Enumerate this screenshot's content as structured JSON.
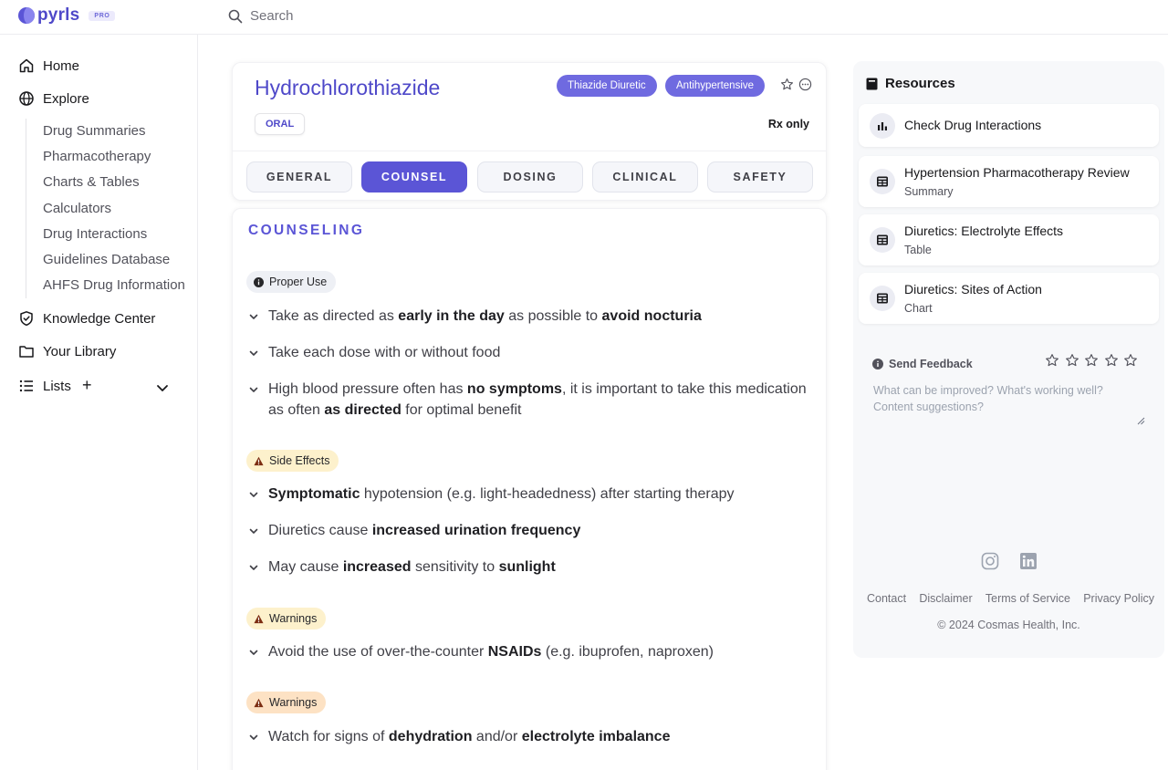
{
  "app": {
    "name": "pyrls",
    "badge": "PRO"
  },
  "search": {
    "placeholder": "Search"
  },
  "sidebar": {
    "home": "Home",
    "explore": "Explore",
    "explore_items": [
      "Drug Summaries",
      "Pharmacotherapy",
      "Charts & Tables",
      "Calculators",
      "Drug Interactions",
      "Guidelines Database",
      "AHFS Drug Information"
    ],
    "knowledge": "Knowledge Center",
    "library": "Your Library",
    "lists": "Lists",
    "lists_add": "+"
  },
  "drug": {
    "name": "Hydrochlorothiazide",
    "tags": [
      "Thiazide Diuretic",
      "Antihypertensive"
    ],
    "route": "ORAL",
    "rx": "Rx only"
  },
  "tabs": [
    {
      "label": "GENERAL",
      "active": false
    },
    {
      "label": "COUNSEL",
      "active": true
    },
    {
      "label": "DOSING",
      "active": false
    },
    {
      "label": "CLINICAL",
      "active": false
    },
    {
      "label": "SAFETY",
      "active": false
    }
  ],
  "counseling": {
    "heading": "COUNSELING",
    "sections": [
      {
        "badge": "Proper Use",
        "style": "gray",
        "icon": "info-icon",
        "items": [
          [
            [
              "Take as directed as ",
              false
            ],
            [
              "early in the day",
              true
            ],
            [
              " as possible to ",
              false
            ],
            [
              "avoid nocturia",
              true
            ]
          ],
          [
            [
              "Take each dose with or without food",
              false
            ]
          ],
          [
            [
              "High blood pressure often has ",
              false
            ],
            [
              "no symptoms",
              true
            ],
            [
              ", it is important to take this medication as often ",
              false
            ],
            [
              "as directed",
              true
            ],
            [
              " for optimal benefit",
              false
            ]
          ]
        ]
      },
      {
        "badge": "Side Effects",
        "style": "yellow",
        "icon": "warning-icon",
        "items": [
          [
            [
              "Symptomatic",
              true
            ],
            [
              " hypotension (e.g. light-headedness) after starting therapy",
              false
            ]
          ],
          [
            [
              "Diuretics cause ",
              false
            ],
            [
              "increased urination frequency",
              true
            ]
          ],
          [
            [
              "May cause ",
              false
            ],
            [
              "increased",
              true
            ],
            [
              " sensitivity to ",
              false
            ],
            [
              "sunlight",
              true
            ]
          ]
        ]
      },
      {
        "badge": "Warnings",
        "style": "yellow",
        "icon": "warning-icon",
        "items": [
          [
            [
              "Avoid the use of over-the-counter ",
              false
            ],
            [
              "NSAIDs",
              true
            ],
            [
              " (e.g. ibuprofen, naproxen)",
              false
            ]
          ]
        ]
      },
      {
        "badge": "Warnings",
        "style": "orange",
        "icon": "warning-icon",
        "items": [
          [
            [
              "Watch for signs of ",
              false
            ],
            [
              "dehydration",
              true
            ],
            [
              " and/or ",
              false
            ],
            [
              "electrolyte imbalance",
              true
            ]
          ]
        ]
      }
    ]
  },
  "resources": {
    "title": "Resources",
    "items": [
      {
        "name": "Check Drug Interactions",
        "sub": "",
        "icon": "bar-chart-icon"
      },
      {
        "name": "Hypertension Pharmacotherapy Review",
        "sub": "Summary",
        "icon": "table-icon"
      },
      {
        "name": "Diuretics: Electrolyte Effects",
        "sub": "Table",
        "icon": "table-icon"
      },
      {
        "name": "Diuretics: Sites of Action",
        "sub": "Chart",
        "icon": "table-icon"
      }
    ]
  },
  "feedback": {
    "label": "Send Feedback",
    "placeholder": "What can be improved? What's working well? Content suggestions?",
    "stars": 5
  },
  "footer": {
    "links": [
      "Contact",
      "Disclaimer",
      "Terms of Service",
      "Privacy Policy"
    ],
    "copyright": "© 2024 Cosmas Health, Inc."
  },
  "colors": {
    "accent": "#5b55d6",
    "tag": "#6f6ae0",
    "warning_bg": "#fdf1cc",
    "danger_bg": "#fde2c4"
  }
}
